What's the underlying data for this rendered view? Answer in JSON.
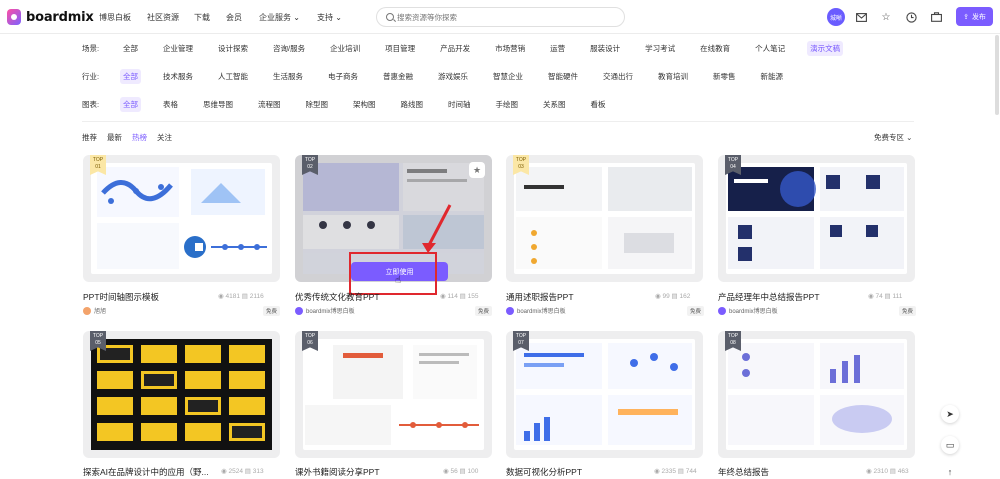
{
  "header": {
    "logo_text": "boardmix",
    "nav": [
      "博思白板",
      "社区资源",
      "下载",
      "会员",
      "企业服务 ⌄",
      "支持 ⌄"
    ],
    "search_placeholder": "搜索资源等你探索",
    "avatar_text": "城晰",
    "icons": [
      "mail-icon",
      "star-icon",
      "clock-icon",
      "briefcase-icon"
    ],
    "publish_label": "发布"
  },
  "filters": [
    {
      "label": "场景:",
      "options": [
        "全部",
        "企业管理",
        "设计探索",
        "咨询/服务",
        "企业培训",
        "项目管理",
        "产品开发",
        "市场营销",
        "运营",
        "服装设计",
        "学习考试",
        "在线教育",
        "个人笔记",
        "演示文稿"
      ],
      "active": 13
    },
    {
      "label": "行业:",
      "options": [
        "全部",
        "技术服务",
        "人工智能",
        "生活服务",
        "电子商务",
        "普惠金融",
        "游戏娱乐",
        "智慧企业",
        "智能硬件",
        "交通出行",
        "教育培训",
        "新零售",
        "新能源"
      ],
      "active": 0
    },
    {
      "label": "图表:",
      "options": [
        "全部",
        "表格",
        "思维导图",
        "流程图",
        "除型图",
        "架构图",
        "路线图",
        "时间轴",
        "手绘图",
        "关系图",
        "看板"
      ],
      "active": 0
    }
  ],
  "sort": {
    "options": [
      "推荐",
      "最新",
      "热榜",
      "关注"
    ],
    "active": 2
  },
  "free_zone_label": "免费专区 ⌄",
  "cards": [
    {
      "rank": "TOP\n01",
      "title": "PPT时间轴图示模板",
      "views": "4181",
      "copies": "2116",
      "author": "旭旭",
      "tag": "免费"
    },
    {
      "rank": "TOP\n02",
      "title": "优秀传统文化教育PPT",
      "views": "114",
      "copies": "155",
      "author": "boardmix博思白板",
      "tag": "免费",
      "hovered": true,
      "use_label": "立即使用"
    },
    {
      "rank": "TOP\n03",
      "title": "通用述职报告PPT",
      "views": "99",
      "copies": "162",
      "author": "boardmix博思白板",
      "tag": "免费"
    },
    {
      "rank": "TOP\n04",
      "title": "产品经理年中总结报告PPT",
      "views": "74",
      "copies": "111",
      "author": "boardmix博思白板",
      "tag": "免费"
    },
    {
      "rank": "TOP\n05",
      "title": "探索AI在品牌设计中的应用（野...",
      "views": "2524",
      "copies": "313"
    },
    {
      "rank": "TOP\n06",
      "title": "课外书籍阅读分享PPT",
      "views": "56",
      "copies": "100"
    },
    {
      "rank": "TOP\n07",
      "title": "数据可视化分析PPT",
      "views": "2335",
      "copies": "744"
    },
    {
      "rank": "TOP\n08",
      "title": "年终总结报告",
      "views": "2310",
      "copies": "463"
    }
  ],
  "colors": {
    "accent": "#7b5cff",
    "highlight": "#e0282e"
  }
}
